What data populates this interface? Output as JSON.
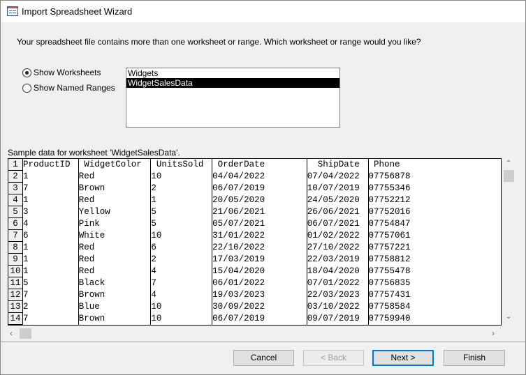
{
  "window": {
    "title": "Import Spreadsheet Wizard"
  },
  "instruction": "Your spreadsheet file contains more than one worksheet or range. Which worksheet or range would you like?",
  "options": [
    {
      "label": "Show Worksheets",
      "selected": true
    },
    {
      "label": "Show Named Ranges",
      "selected": false
    }
  ],
  "sheets": [
    {
      "label": "Widgets",
      "selected": false
    },
    {
      "label": "WidgetSalesData",
      "selected": true
    }
  ],
  "sample_label": "Sample data for worksheet 'WidgetSalesData'.",
  "table": {
    "headers": [
      "ProductID",
      " WidgetColor",
      " UnitsSold",
      " OrderDate",
      "  ShipDate",
      " Phone"
    ],
    "rows": [
      [
        "1",
        "Red",
        "10",
        "04/04/2022",
        "07/04/2022",
        "07756878"
      ],
      [
        "7",
        "Brown",
        "2",
        "06/07/2019",
        "10/07/2019",
        "07755346"
      ],
      [
        "1",
        "Red",
        "1",
        "20/05/2020",
        "24/05/2020",
        "07752212"
      ],
      [
        "3",
        "Yellow",
        "5",
        "21/06/2021",
        "26/06/2021",
        "07752016"
      ],
      [
        "4",
        "Pink",
        "5",
        "05/07/2021",
        "06/07/2021",
        "07754847"
      ],
      [
        "6",
        "White",
        "10",
        "31/01/2022",
        "01/02/2022",
        "07757061"
      ],
      [
        "1",
        "Red",
        "6",
        "22/10/2022",
        "27/10/2022",
        "07757221"
      ],
      [
        "1",
        "Red",
        "2",
        "17/03/2019",
        "22/03/2019",
        "07758812"
      ],
      [
        "1",
        "Red",
        "4",
        "15/04/2020",
        "18/04/2020",
        "07755478"
      ],
      [
        "5",
        "Black",
        "7",
        "06/01/2022",
        "07/01/2022",
        "07756835"
      ],
      [
        "7",
        "Brown",
        "4",
        "19/03/2023",
        "22/03/2023",
        "07757431"
      ],
      [
        "2",
        "Blue",
        "10",
        "30/09/2022",
        "03/10/2022",
        "07758584"
      ],
      [
        "7",
        "Brown",
        "10",
        "06/07/2019",
        "09/07/2019",
        "07759940"
      ]
    ]
  },
  "buttons": {
    "cancel": "Cancel",
    "back": "< Back",
    "next": "Next >",
    "finish": "Finish"
  }
}
